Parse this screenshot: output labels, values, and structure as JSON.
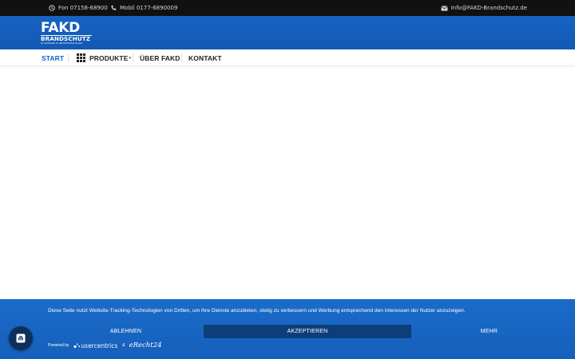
{
  "topbar": {
    "phone": "Fon 07158-68900",
    "mobile": "Mobil 0177-6890009",
    "email": "Info@FAKD-Brandschutz.de"
  },
  "logo": {
    "line1": "FAKD",
    "line2": "BRANDSCHUTZ",
    "line3": "Ihr Fachhändler für HEKATRON Brandmelder"
  },
  "nav": {
    "items": [
      {
        "label": "START"
      },
      {
        "label": "PRODUKTE"
      },
      {
        "label": "ÜBER FAKD"
      },
      {
        "label": "KONTAKT"
      }
    ],
    "active": "START"
  },
  "cookie": {
    "text": "Diese Seite nutzt Website-Tracking-Technologien von Dritten, um ihre Dienste anzubieten, stetig zu verbessern und Werbung entsprechend den Interessen der Nutzer anzuzeigen.",
    "deny_label": "ABLEHNEN",
    "accept_label": "AKZEPTIEREN",
    "more_label": "MEHR",
    "powered_by": "Powered by",
    "brand1": "usercentrics",
    "amp": "&",
    "brand2": "eRecht24"
  },
  "colors": {
    "brand_blue": "#1565c0",
    "topbar": "#111111",
    "accept_button": "#0e3e7a"
  }
}
